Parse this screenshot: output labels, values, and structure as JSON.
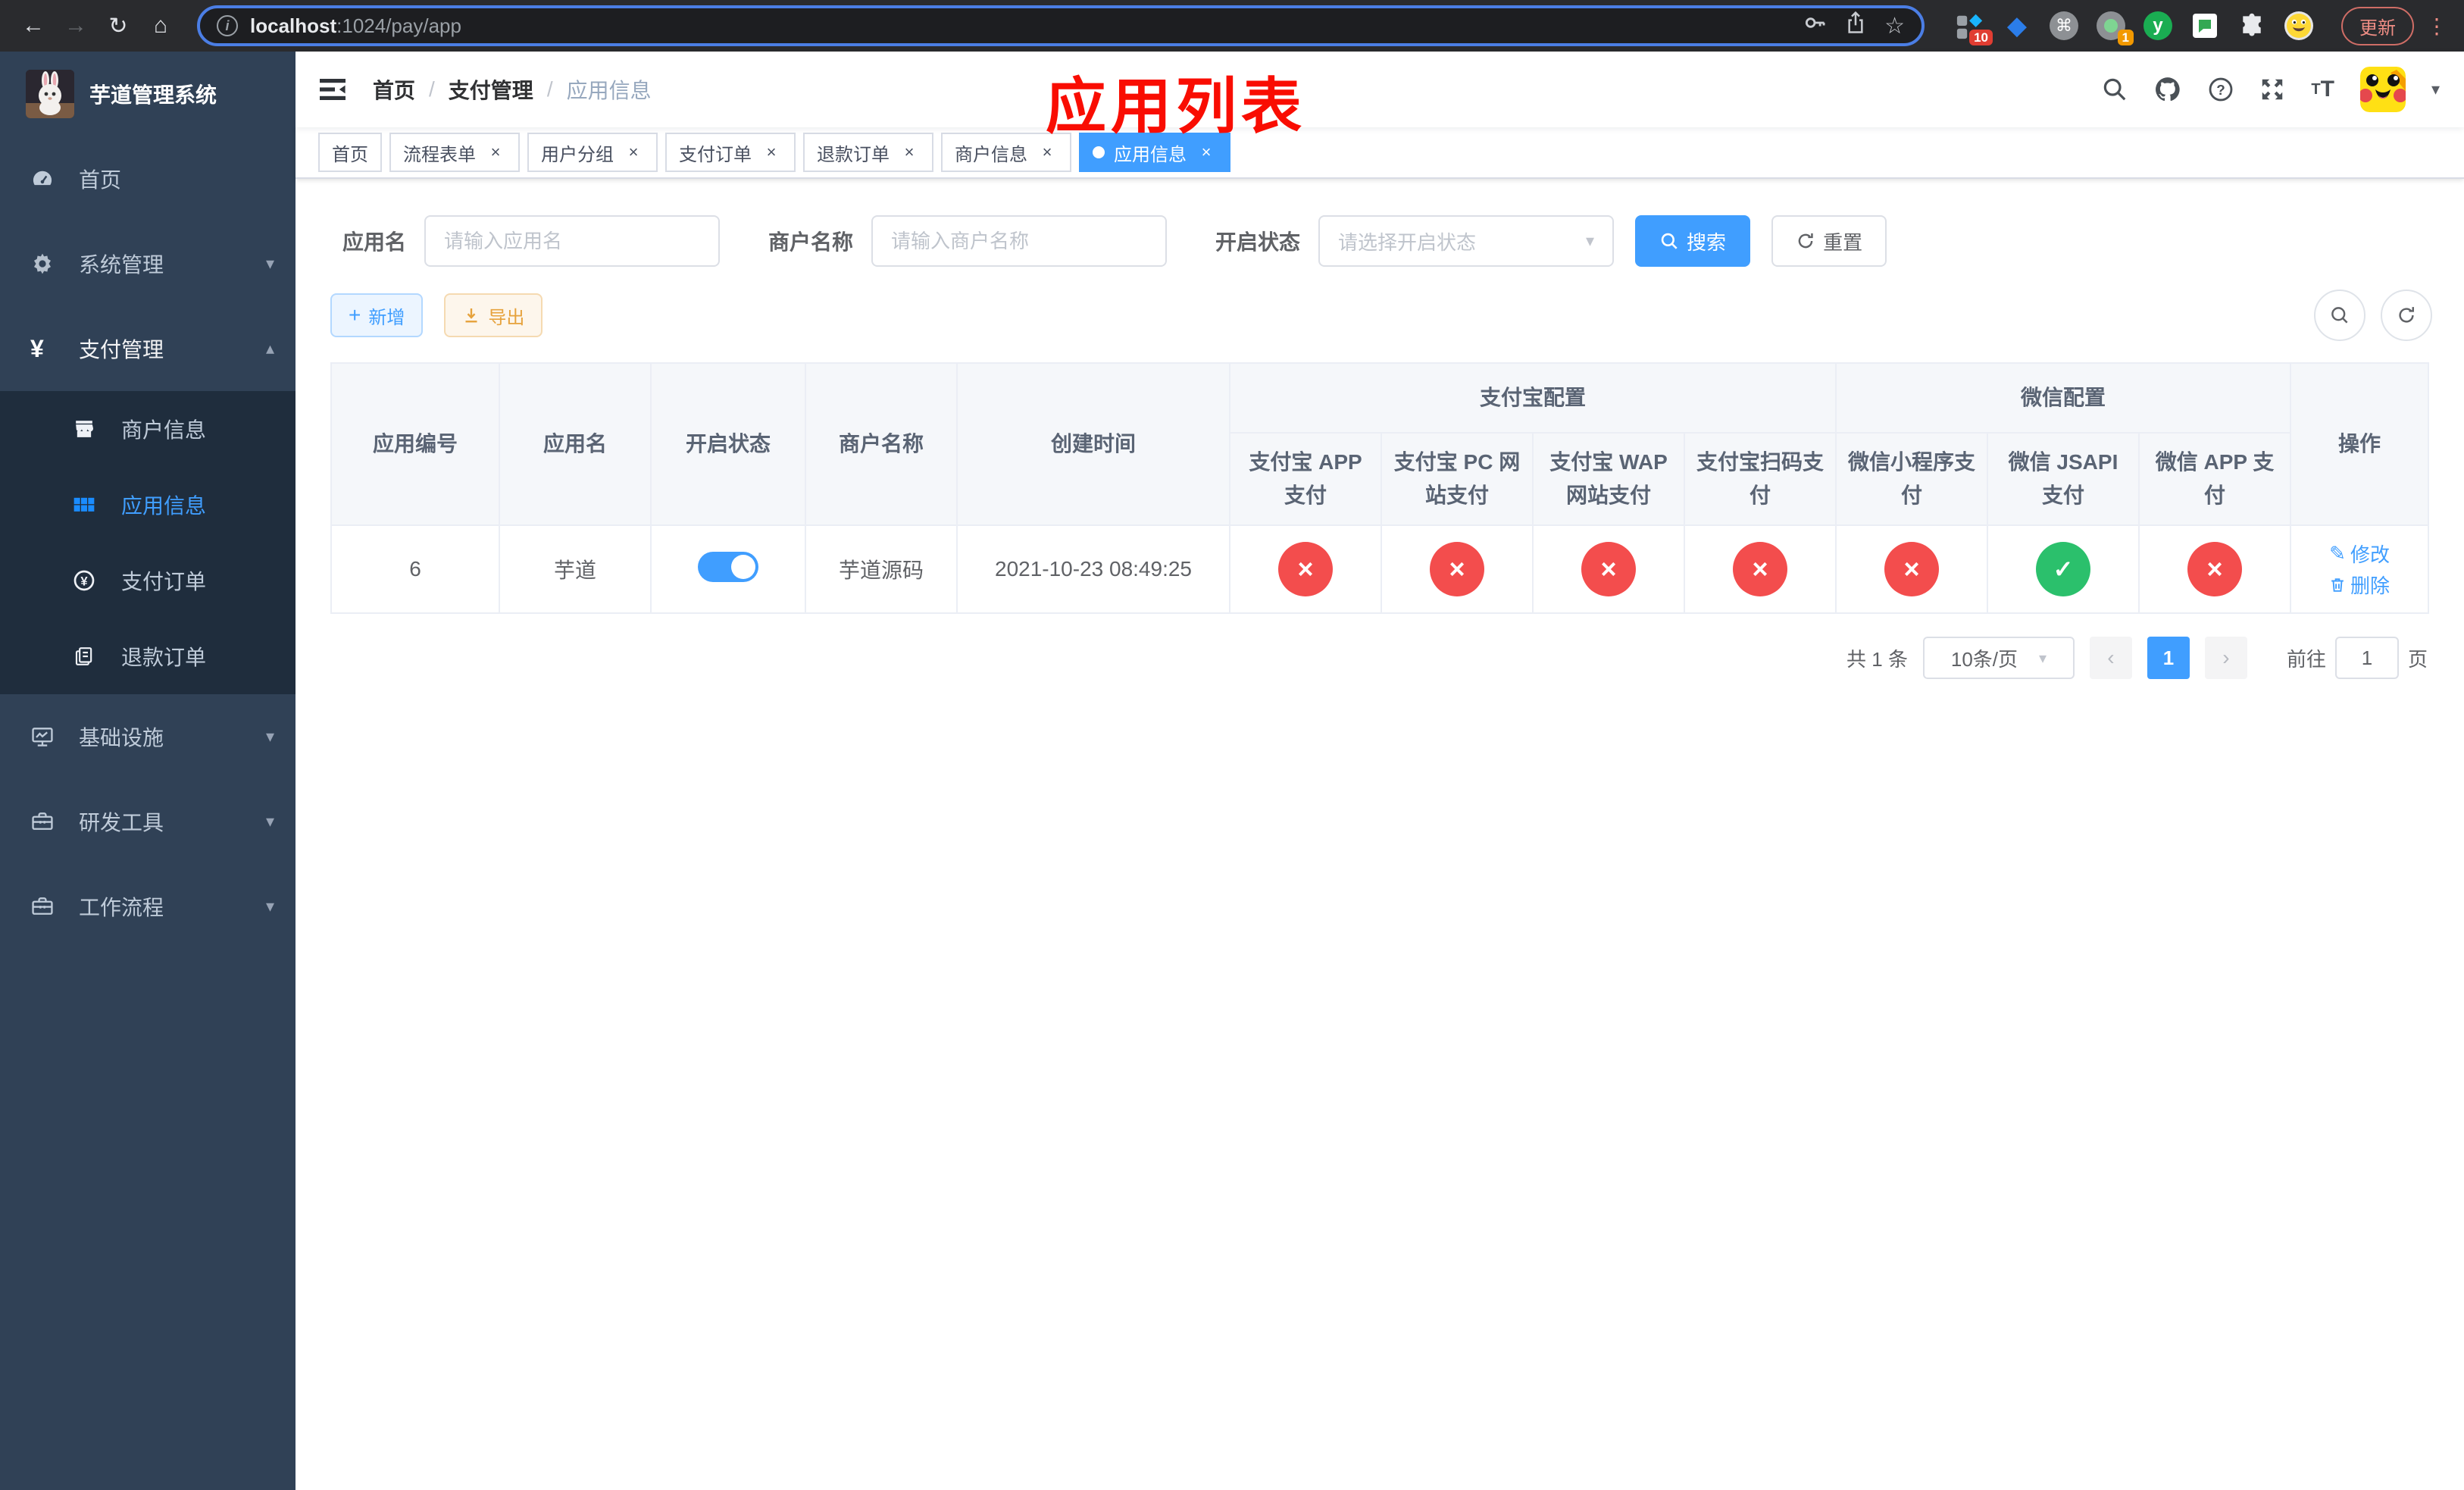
{
  "browser": {
    "url_host": "localhost",
    "url_rest": ":1024/pay/app",
    "update_label": "更新",
    "ext_badges": {
      "pinned_tool": "10",
      "recorder": "1"
    }
  },
  "sidebar": {
    "title": "芋道管理系统",
    "items": [
      {
        "label": "首页"
      },
      {
        "label": "系统管理"
      },
      {
        "label": "支付管理"
      }
    ],
    "subitems": [
      {
        "label": "商户信息"
      },
      {
        "label": "应用信息"
      },
      {
        "label": "支付订单"
      },
      {
        "label": "退款订单"
      }
    ],
    "items_bottom": [
      {
        "label": "基础设施"
      },
      {
        "label": "研发工具"
      },
      {
        "label": "工作流程"
      }
    ]
  },
  "navbar": {
    "breadcrumb": {
      "home": "首页",
      "section": "支付管理",
      "current": "应用信息"
    }
  },
  "annotation": {
    "text": "应用列表"
  },
  "tabs": [
    {
      "label": "首页"
    },
    {
      "label": "流程表单"
    },
    {
      "label": "用户分组"
    },
    {
      "label": "支付订单"
    },
    {
      "label": "退款订单"
    },
    {
      "label": "商户信息"
    },
    {
      "label": "应用信息"
    }
  ],
  "filters": {
    "app_name_label": "应用名",
    "app_name_placeholder": "请输入应用名",
    "merchant_label": "商户名称",
    "merchant_placeholder": "请输入商户名称",
    "status_label": "开启状态",
    "status_placeholder": "请选择开启状态",
    "search_label": "搜索",
    "reset_label": "重置"
  },
  "toolbar": {
    "add_label": "新增",
    "export_label": "导出"
  },
  "table": {
    "columns": {
      "id": "应用编号",
      "name": "应用名",
      "status": "开启状态",
      "merchant": "商户名称",
      "created": "创建时间",
      "alipay_group": "支付宝配置",
      "wechat_group": "微信配置",
      "ops": "操作",
      "pay_cols": [
        "支付宝 APP 支付",
        "支付宝 PC 网站支付",
        "支付宝 WAP 网站支付",
        "支付宝扫码支付",
        "微信小程序支付",
        "微信 JSAPI 支付",
        "微信 APP 支付"
      ]
    },
    "row": {
      "id": "6",
      "name": "芋道",
      "enabled": true,
      "merchant": "芋道源码",
      "created": "2021-10-23 08:49:25",
      "statuses": [
        "cross",
        "cross",
        "cross",
        "cross",
        "cross",
        "check",
        "cross"
      ],
      "edit_label": "修改",
      "delete_label": "删除"
    }
  },
  "pagination": {
    "total_label": "共 1 条",
    "page_size": "10条/页",
    "current_page": "1",
    "goto_label": "前往",
    "goto_value": "1",
    "page_label": "页"
  },
  "colors": {
    "primary": "#409eff",
    "success": "#2bc06c",
    "danger": "#f34d4d",
    "warning": "#e6a23c",
    "sidebar_bg": "#304156",
    "submenu_bg": "#1f2d3d",
    "annotation_red": "#f90d02"
  }
}
